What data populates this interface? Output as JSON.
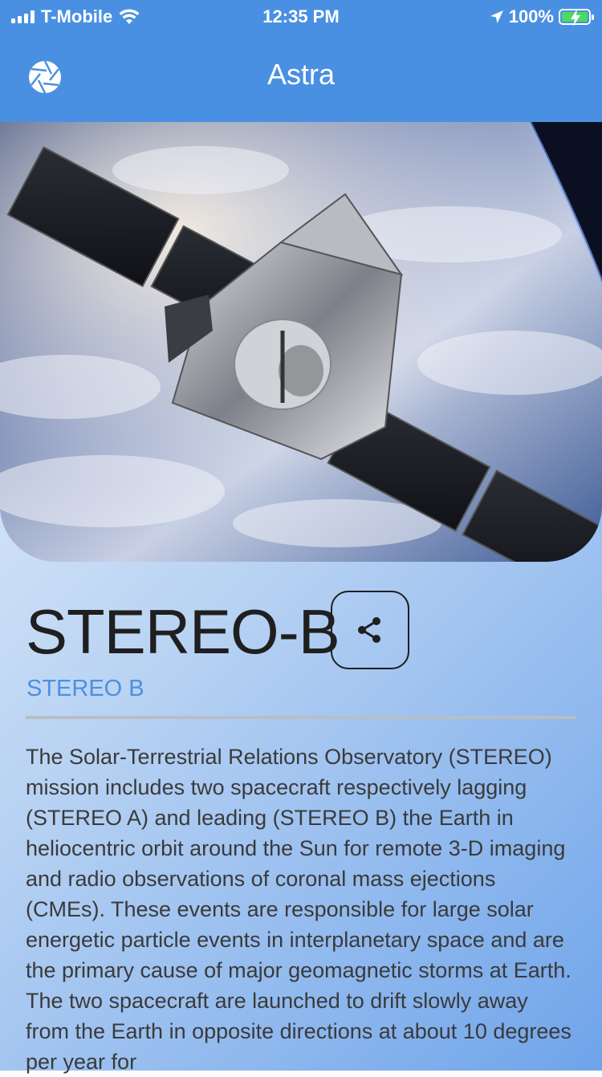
{
  "status_bar": {
    "carrier": "T-Mobile",
    "time": "12:35 PM",
    "battery": "100%",
    "colors": {
      "battery_fill": "#4cd964"
    }
  },
  "nav": {
    "title": "Astra",
    "icon": "camera-shutter-icon",
    "background_color": "#4a90e2"
  },
  "hero": {
    "icon": "satellite-image"
  },
  "mission": {
    "name": "STEREO-B",
    "subtitle": "STEREO B",
    "share_icon": "share-icon",
    "description": "The Solar-Terrestrial Relations Observatory (STEREO) mission includes two spacecraft respectively lagging (STEREO A) and leading (STEREO B) the Earth in heliocentric orbit around the Sun for remote 3-D imaging and radio observations of coronal mass ejections (CMEs). These events are responsible for large solar energetic particle events in interplanetary space and are the primary cause of major geomagnetic storms at Earth. The two spacecraft are launched to drift slowly away from the Earth in opposite directions at about 10 degrees per year for"
  }
}
